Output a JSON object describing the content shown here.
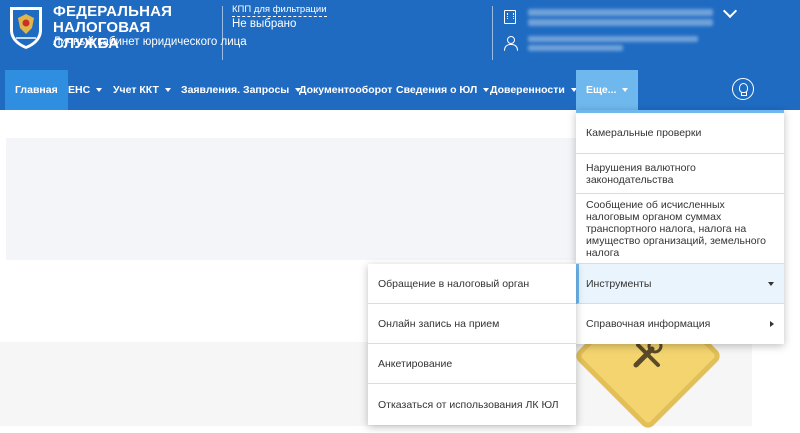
{
  "header": {
    "brand_title": "ФЕДЕРАЛЬНАЯ НАЛОГОВАЯ СЛУЖБА",
    "brand_subtitle": "Личный кабинет юридического лица",
    "kpp_label": "КПП для фильтрации",
    "kpp_value": "Не выбрано"
  },
  "nav": {
    "items": [
      {
        "label": "Главная"
      },
      {
        "label": "ЕНС"
      },
      {
        "label": "Учет ККТ"
      },
      {
        "label": "Заявления. Запросы"
      },
      {
        "label": "Документооборот"
      },
      {
        "label": "Сведения о ЮЛ"
      },
      {
        "label": "Доверенности"
      },
      {
        "label": "Еще..."
      }
    ]
  },
  "more_menu": {
    "items": [
      {
        "label": "Камеральные проверки"
      },
      {
        "label": "Нарушения валютного законодательства"
      },
      {
        "label": "Сообщение об исчисленных налоговым органом суммах транспортного налога, налога на имущество организаций, земельного налога"
      },
      {
        "label": "Инструменты"
      },
      {
        "label": "Справочная информация"
      }
    ]
  },
  "tools_submenu": {
    "items": [
      {
        "label": "Обращение в налоговый орган"
      },
      {
        "label": "Онлайн запись на прием"
      },
      {
        "label": "Анкетирование"
      },
      {
        "label": "Отказаться от использования ЛК ЮЛ"
      }
    ]
  },
  "colors": {
    "header_blue": "#1f6bc2",
    "active_blue": "#2f8ee0",
    "more_blue": "#6fb8ee"
  }
}
